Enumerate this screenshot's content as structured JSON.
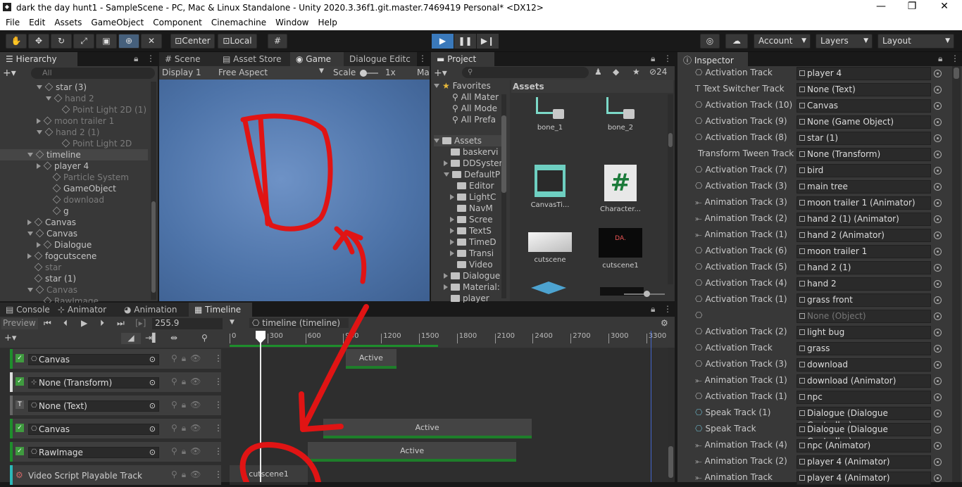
{
  "window": {
    "title": "dark the day hunt1 - SampleScene - PC, Mac & Linux Standalone - Unity 2020.3.36f1.git.master.7469419 Personal* <DX12>",
    "min": "—",
    "max": "❐",
    "close": "✕"
  },
  "menu": [
    "File",
    "Edit",
    "Assets",
    "GameObject",
    "Component",
    "Cinemachine",
    "Window",
    "Help"
  ],
  "toolbar": {
    "center": "Center",
    "local": "Local",
    "account": "Account",
    "layers": "Layers",
    "layout": "Layout"
  },
  "hierarchy": {
    "tab": "Hierarchy",
    "search": "All",
    "items": [
      {
        "label": "star (3)",
        "dim": false
      },
      {
        "label": "hand 2",
        "dim": true
      },
      {
        "label": "Point Light 2D (1)",
        "dim": true
      },
      {
        "label": "moon trailer 1",
        "dim": true
      },
      {
        "label": "hand 2 (1)",
        "dim": true
      },
      {
        "label": "Point Light 2D",
        "dim": true
      },
      {
        "label": "timeline",
        "dim": false
      },
      {
        "label": "player 4",
        "dim": false
      },
      {
        "label": "Particle System",
        "dim": true
      },
      {
        "label": "GameObject",
        "dim": false
      },
      {
        "label": "download",
        "dim": true
      },
      {
        "label": "g",
        "dim": false
      },
      {
        "label": "Canvas",
        "dim": false
      },
      {
        "label": "Canvas",
        "dim": false
      },
      {
        "label": "Dialogue",
        "dim": false
      },
      {
        "label": "fogcutscene",
        "dim": false
      },
      {
        "label": "star",
        "dim": true
      },
      {
        "label": "star (1)",
        "dim": false
      },
      {
        "label": "Canvas",
        "dim": true
      },
      {
        "label": "RawImage",
        "dim": true
      }
    ]
  },
  "scene": {
    "tabs": [
      "Scene",
      "Asset Store",
      "Game",
      "Dialogue Editc"
    ],
    "display": "Display 1",
    "aspect": "Free Aspect",
    "scale_label": "Scale",
    "scale_value": "1x",
    "ma": "Ma"
  },
  "project": {
    "tab": "Project",
    "count": "24",
    "favorites": "Favorites",
    "fav_items": [
      "All Mater",
      "All Mode",
      "All Prefa"
    ],
    "assets_root": "Assets",
    "folders": [
      "baskervi",
      "DDSyster",
      "DefaultP",
      "Editor",
      "LightC",
      "NavM",
      "Scree",
      "TextS",
      "TimeD",
      "Transi",
      "Video",
      "Dialogue",
      "Material:",
      "player"
    ],
    "grid_title": "Assets",
    "grid": [
      {
        "label": "bone_1"
      },
      {
        "label": "bone_2"
      },
      {
        "label": "CanvasTi..."
      },
      {
        "label": "Character..."
      },
      {
        "label": "cutscene"
      },
      {
        "label": "cutscene1"
      }
    ]
  },
  "bottom": {
    "tabs": [
      "Console",
      "Animator",
      "Animation",
      "Timeline"
    ],
    "preview": "Preview",
    "frame": "255.9",
    "asset": "timeline (timeline)",
    "ruler": [
      "0",
      "300",
      "600",
      "900",
      "1200",
      "1500",
      "1800",
      "2100",
      "2400",
      "2700",
      "3000",
      "3300"
    ],
    "tracks": [
      {
        "label": "Canvas",
        "color": "#1e8e2c"
      },
      {
        "label": "None (Transform)",
        "color": "#dddddd"
      },
      {
        "label": "None (Text)",
        "color": "#666666"
      },
      {
        "label": "Canvas",
        "color": "#1e8e2c"
      },
      {
        "label": "RawImage",
        "color": "#1e8e2c"
      },
      {
        "label": "Video Script Playable Track",
        "color": "#2cb8b8"
      }
    ],
    "clips": [
      "Active",
      "Active",
      "Active",
      "cutscene1"
    ]
  },
  "inspector": {
    "tab": "Inspector",
    "rows": [
      {
        "track": "Activation Track",
        "binding": "player 4"
      },
      {
        "track": "Text Switcher Track",
        "binding": "None (Text)"
      },
      {
        "track": "Activation Track (10)",
        "binding": "Canvas"
      },
      {
        "track": "Activation Track (9)",
        "binding": "None (Game Object)"
      },
      {
        "track": "Activation Track (8)",
        "binding": "star (1)"
      },
      {
        "track": "Transform Tween Track",
        "binding": "None (Transform)"
      },
      {
        "track": "Activation Track (7)",
        "binding": "bird"
      },
      {
        "track": "Activation Track (3)",
        "binding": "main tree"
      },
      {
        "track": "Animation Track (3)",
        "binding": "moon trailer 1 (Animator)"
      },
      {
        "track": "Animation Track (2)",
        "binding": "hand 2 (1) (Animator)"
      },
      {
        "track": "Animation Track (1)",
        "binding": "hand 2 (Animator)"
      },
      {
        "track": "Activation Track (6)",
        "binding": "moon trailer 1"
      },
      {
        "track": "Activation Track (5)",
        "binding": "hand 2 (1)"
      },
      {
        "track": "Activation Track (4)",
        "binding": "hand 2"
      },
      {
        "track": "Activation Track (1)",
        "binding": "grass front"
      },
      {
        "track": "",
        "binding": "None (Object)"
      },
      {
        "track": "Activation Track (2)",
        "binding": "light bug"
      },
      {
        "track": "Activation Track",
        "binding": "grass"
      },
      {
        "track": "Activation Track (3)",
        "binding": "download"
      },
      {
        "track": "Animation Track (1)",
        "binding": "download (Animator)"
      },
      {
        "track": "Activation Track (1)",
        "binding": "npc"
      },
      {
        "track": "Speak Track (1)",
        "binding": "Dialogue (Dialogue Controller)"
      },
      {
        "track": "Speak Track",
        "binding": "Dialogue (Dialogue Controller)"
      },
      {
        "track": "Animation Track (4)",
        "binding": "npc (Animator)"
      },
      {
        "track": "Animation Track (2)",
        "binding": "player 4 (Animator)"
      },
      {
        "track": "Animation Track",
        "binding": "player 4 (Animator)"
      }
    ]
  }
}
